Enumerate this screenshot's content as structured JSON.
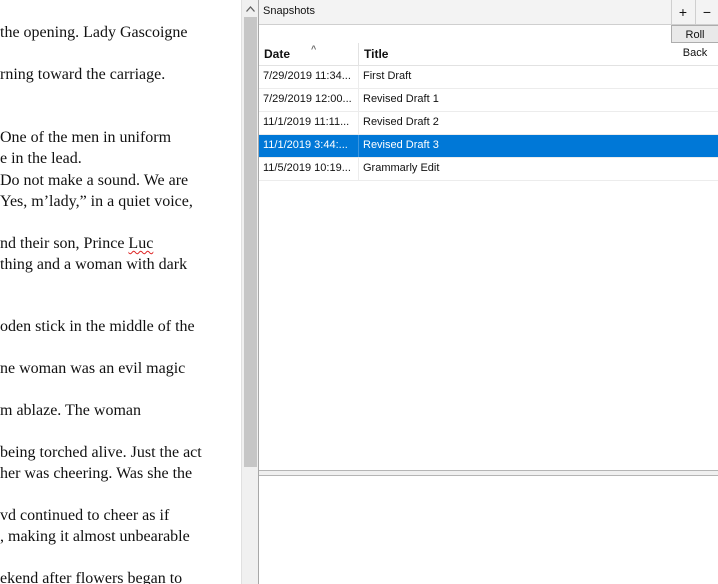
{
  "editor": {
    "lines": [
      {
        "text": "the opening. Lady Gascoigne"
      },
      {
        "text": "rning toward the carriage."
      },
      {
        "text": "One of the men in uniform"
      },
      {
        "text": "e in the lead."
      },
      {
        "text": "Do not make a sound. We are"
      },
      {
        "text": "Yes, m’lady,” in a quiet voice,"
      },
      {
        "text": "nd their son, Prince Luc"
      },
      {
        "text": "thing and a woman with dark"
      },
      {
        "text": "oden stick in the middle of the"
      },
      {
        "text": "ne woman was an evil magic"
      },
      {
        "text": "m ablaze. The woman"
      },
      {
        "text": "being torched alive. Just the act"
      },
      {
        "text": "her was cheering. Was she the"
      },
      {
        "text": "vd continued to cheer as if"
      },
      {
        "text": ", making it almost unbearable"
      },
      {
        "text": "ekend after flowers began to"
      }
    ],
    "squiggle_word": "Luc"
  },
  "snapshots": {
    "title": "Snapshots",
    "add_label": "+",
    "remove_label": "−",
    "rollback_label": "Roll Back",
    "columns": {
      "date": "Date",
      "title": "Title"
    },
    "rows": [
      {
        "date": "7/29/2019 11:34...",
        "title": "First Draft",
        "selected": false
      },
      {
        "date": "7/29/2019 12:00...",
        "title": "Revised Draft 1",
        "selected": false
      },
      {
        "date": "11/1/2019 11:11...",
        "title": "Revised Draft 2",
        "selected": false
      },
      {
        "date": "11/1/2019 3:44:...",
        "title": "Revised Draft 3",
        "selected": true
      },
      {
        "date": "11/5/2019 10:19...",
        "title": "Grammarly Edit",
        "selected": false
      }
    ]
  },
  "colors": {
    "selection": "#0078d7"
  },
  "icons": {
    "sort": "sort-ascending-icon",
    "scroll_up": "scroll-up-arrow-icon"
  }
}
